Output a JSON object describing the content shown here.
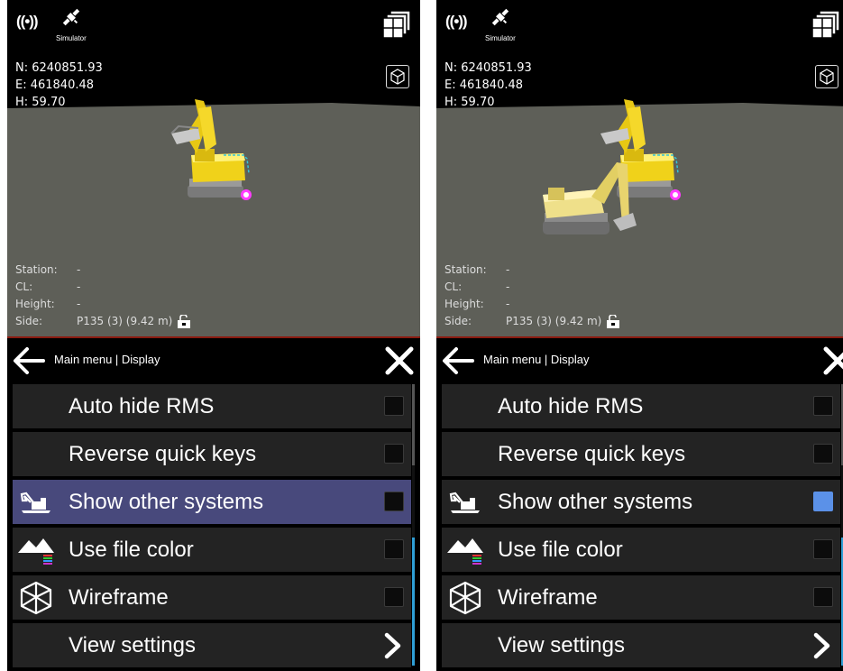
{
  "hud": {
    "signal_icon": "((•))",
    "simulator_label": "Simulator",
    "coords": {
      "n": "N: 6240851.93",
      "e": "E: 461840.48",
      "h": "H: 59.70"
    },
    "info": {
      "station_key": "Station:",
      "station_val": "-",
      "cl_key": "CL:",
      "cl_val": "-",
      "height_key": "Height:",
      "height_val": "-",
      "side_key": "Side:",
      "side_val": "P135 (3) (9.42 m)"
    }
  },
  "header": {
    "breadcrumb": "Main menu | Display"
  },
  "menu": {
    "auto_hide": "Auto hide RMS",
    "reverse_keys": "Reverse quick keys",
    "show_other": "Show other systems",
    "file_color": "Use file color",
    "wireframe": "Wireframe",
    "view_settings": "View settings"
  },
  "states": {
    "left": {
      "show_other_systems_checked": false,
      "show_other_systems_highlighted": true,
      "other_machine_visible": false
    },
    "right": {
      "show_other_systems_checked": true,
      "show_other_systems_highlighted": false,
      "other_machine_visible": true
    }
  },
  "icons": [
    "signal-icon",
    "satellite-icon",
    "layers-icon",
    "cube-icon",
    "unlock-icon",
    "back-arrow-icon",
    "close-icon",
    "excavator-icon",
    "mountains-icon",
    "wireframe-cube-icon",
    "chevron-right-icon"
  ],
  "colors": {
    "accent": "#5b91e8",
    "highlight_row": "#48497c",
    "ground": "#5e5f58",
    "machine": "#f0d21a",
    "marker": "#ff3cff",
    "scrollbar": "#2f9fd6"
  }
}
